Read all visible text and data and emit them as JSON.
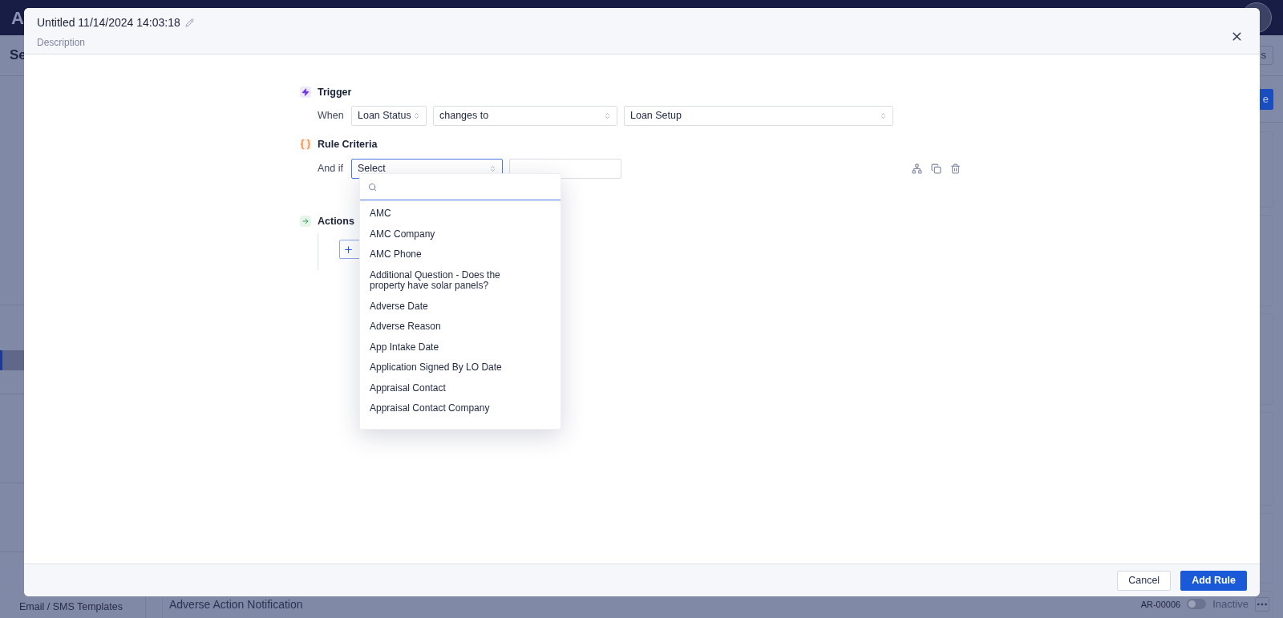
{
  "app_bar": {
    "logo": "A"
  },
  "page_header": {
    "title": "Se",
    "button": "s"
  },
  "sidebar": {
    "sections": [
      {
        "items": [
          {
            "selected": false
          },
          {
            "selected": false
          },
          {
            "selected": false
          },
          {
            "selected": false
          },
          {
            "selected": false
          },
          {
            "selected": false
          },
          {
            "selected": false
          },
          {
            "selected": false
          },
          {
            "selected": false
          },
          {
            "selected": false
          }
        ]
      },
      {
        "items": [
          {
            "selected": false
          },
          {
            "selected": true
          },
          {
            "selected": false
          }
        ]
      },
      {
        "items": [
          {
            "selected": false
          },
          {
            "selected": false
          },
          {
            "selected": false
          }
        ]
      },
      {
        "items": [
          {
            "selected": false
          },
          {
            "selected": false
          }
        ]
      },
      {
        "items": [
          {
            "selected": false
          },
          {
            "selected": false,
            "label": "Email / SMS Templates"
          }
        ]
      }
    ]
  },
  "toolbar": {
    "button": "e"
  },
  "bottom_row": {
    "name": "Adverse Action Notification",
    "id": "AR-00006",
    "on": false,
    "status": "Inactive"
  },
  "modal": {
    "title": "Untitled 11/14/2024 14:03:18",
    "description": "Description",
    "trigger": {
      "heading": "Trigger",
      "when_label": "When",
      "field": "Loan Status",
      "operator": "changes to",
      "value": "Loan Setup"
    },
    "criteria": {
      "heading": "Rule Criteria",
      "and_if_label": "And if",
      "field": "Select",
      "expanded": true
    },
    "dropdown": {
      "options": [
        "AMC",
        "AMC Company",
        "AMC Phone",
        "Additional Question - Does the property have solar panels?",
        "Adverse Date",
        "Adverse Reason",
        "App Intake Date",
        "Application Signed By LO Date",
        "Appraisal Contact",
        "Appraisal Contact Company"
      ]
    },
    "actions": {
      "heading": "Actions"
    },
    "buttons": [
      {
        "label": "Cancel",
        "kind": "secondary"
      },
      {
        "label": "Add Rule",
        "kind": "primary"
      }
    ]
  }
}
